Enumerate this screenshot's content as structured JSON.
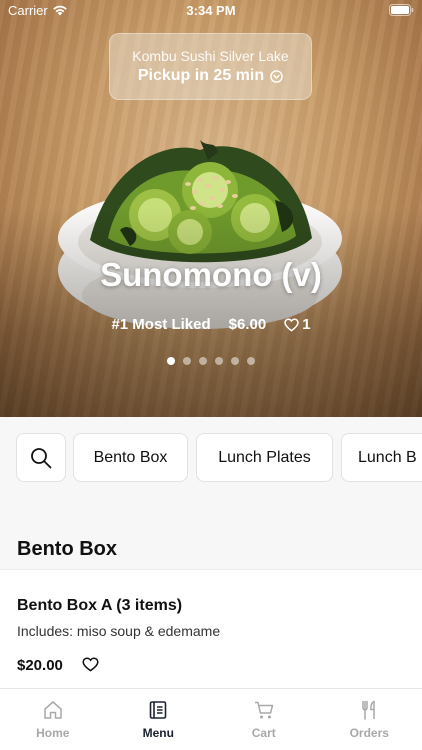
{
  "status_bar": {
    "carrier": "Carrier",
    "time": "3:34 PM"
  },
  "store": {
    "name": "Kombu Sushi Silver Lake",
    "pickup": "Pickup in 25 min"
  },
  "featured": {
    "title": "Sunomono (v)",
    "rank": "#1 Most Liked",
    "price": "$6.00",
    "likes": "1",
    "slide_count": 6,
    "active_slide": 1
  },
  "categories": [
    "Bento Box",
    "Lunch Plates",
    "Lunch B"
  ],
  "section": {
    "title": "Bento Box"
  },
  "item": {
    "name": "Bento Box A (3 items)",
    "description": "Includes: miso soup & edemame",
    "price": "$20.00"
  },
  "tabs": [
    {
      "label": "Home",
      "icon": "home-icon"
    },
    {
      "label": "Menu",
      "icon": "menu-icon",
      "active": true
    },
    {
      "label": "Cart",
      "icon": "cart-icon"
    },
    {
      "label": "Orders",
      "icon": "orders-icon"
    }
  ],
  "colors": {
    "active_tab": "#1c2230",
    "inactive_tab": "#a8a8a8"
  }
}
